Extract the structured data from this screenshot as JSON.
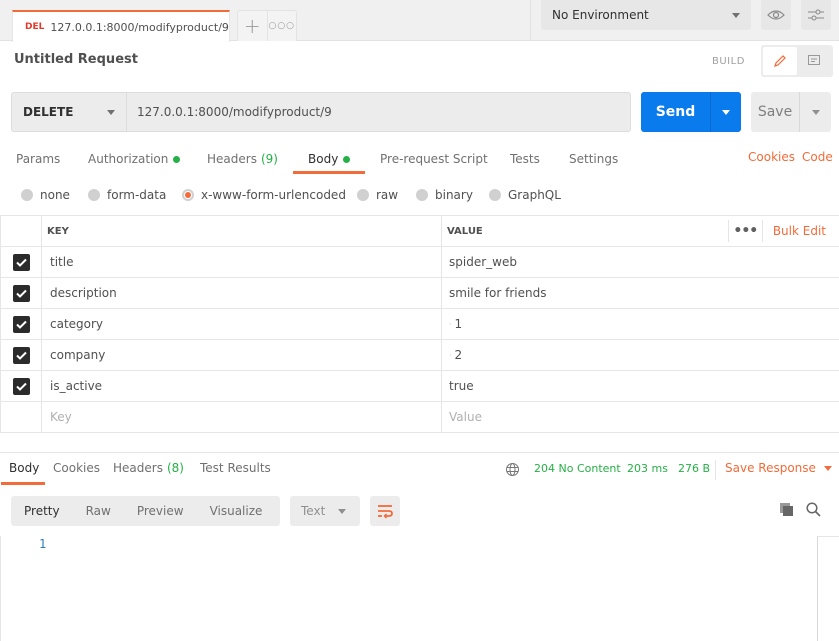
{
  "tabs": {
    "active": {
      "method": "DEL",
      "title": "127.0.0.1:8000/modifyproduct/9",
      "unsaved": true
    },
    "new_tab_icon": "plus-icon",
    "more_icon": "more-horizontal-icon"
  },
  "environment": {
    "selected": "No Environment",
    "eye_icon": "eye-icon",
    "settings_icon": "sliders-icon"
  },
  "request": {
    "title": "Untitled Request",
    "mode_label": "BUILD",
    "method": "DELETE",
    "url": "127.0.0.1:8000/modifyproduct/9",
    "send_label": "Send",
    "save_label": "Save"
  },
  "request_tabs": [
    {
      "label": "Params"
    },
    {
      "label": "Authorization",
      "dot": true
    },
    {
      "label": "Headers",
      "count": "(9)"
    },
    {
      "label": "Body",
      "dot": true,
      "active": true
    },
    {
      "label": "Pre-request Script"
    },
    {
      "label": "Tests"
    },
    {
      "label": "Settings"
    }
  ],
  "links": {
    "cookies": "Cookies",
    "code": "Code"
  },
  "body_types": [
    {
      "label": "none"
    },
    {
      "label": "form-data"
    },
    {
      "label": "x-www-form-urlencoded",
      "selected": true
    },
    {
      "label": "raw"
    },
    {
      "label": "binary"
    },
    {
      "label": "GraphQL"
    }
  ],
  "table": {
    "headers": {
      "key": "KEY",
      "value": "VALUE",
      "bulk_edit": "Bulk Edit"
    },
    "rows": [
      {
        "key": "title",
        "value": "spider_web",
        "checked": true
      },
      {
        "key": "description",
        "value": "smile for friends",
        "checked": true
      },
      {
        "key": "category",
        "value": "1",
        "checked": true
      },
      {
        "key": "company",
        "value": "2",
        "checked": true
      },
      {
        "key": "is_active",
        "value": "true",
        "checked": true
      }
    ],
    "placeholder": {
      "key": "Key",
      "value": "Value"
    }
  },
  "response": {
    "tabs": [
      {
        "label": "Body",
        "active": true
      },
      {
        "label": "Cookies"
      },
      {
        "label": "Headers",
        "count": "(8)"
      },
      {
        "label": "Test Results"
      }
    ],
    "status": "204 No Content",
    "time": "203 ms",
    "size": "276 B",
    "save_response": "Save Response",
    "views": [
      "Pretty",
      "Raw",
      "Preview",
      "Visualize"
    ],
    "active_view": "Pretty",
    "format": "Text",
    "line_numbers": [
      "1"
    ]
  },
  "colors": {
    "accent": "#f26b3a",
    "send": "#097bed",
    "success": "#26b047",
    "delete_method": "#e03a2d"
  }
}
